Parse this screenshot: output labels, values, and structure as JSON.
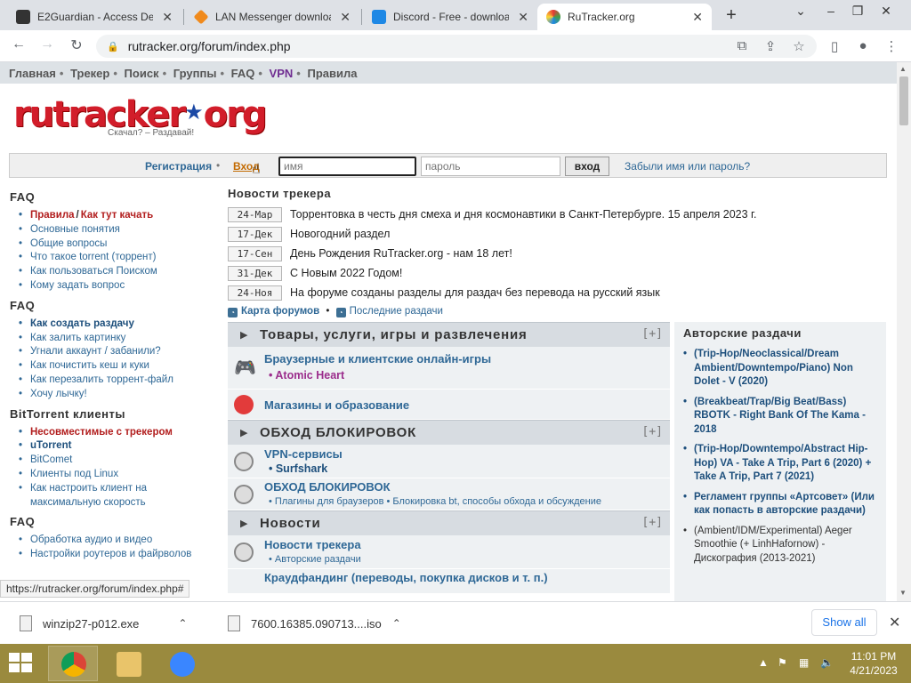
{
  "browser": {
    "tabs": [
      {
        "title": "E2Guardian - Access Den",
        "close": "✕"
      },
      {
        "title": "LAN Messenger downloa",
        "close": "✕"
      },
      {
        "title": "Discord - Free - downloa",
        "close": "✕"
      },
      {
        "title": "RuTracker.org",
        "close": "✕"
      }
    ],
    "url": "rutracker.org/forum/index.php",
    "status_link": "https://rutracker.org/forum/index.php#"
  },
  "topnav": {
    "items": [
      "Главная",
      "Трекер",
      "Поиск",
      "Группы",
      "FAQ",
      "VPN",
      "Правила"
    ]
  },
  "logo": {
    "text": "rutracker",
    "text2": "org",
    "slogan": "Скачал? – Раздавай!"
  },
  "login": {
    "register": "Регистрация",
    "login_link": "Вход",
    "user_placeholder": "имя",
    "pass_placeholder": "пароль",
    "button": "вход",
    "forgot": "Забыли имя или пароль?"
  },
  "sidebar": {
    "sections": [
      {
        "head": "FAQ",
        "items": [
          "Правила",
          "Как тут качать",
          "Основные понятия",
          "Общие вопросы",
          "Что такое torrent (торрент)",
          "Как пользоваться Поиском",
          "Кому задать вопрос"
        ]
      },
      {
        "head": "FAQ",
        "items": [
          "Как создать раздачу",
          "Как залить картинку",
          "Угнали аккаунт / забанили?",
          "Как почистить кеш и куки",
          "Как перезалить торрент-файл",
          "Хочу лычку!"
        ]
      },
      {
        "head": "BitTorrent клиенты",
        "items": [
          "Несовместимые с трекером",
          "uTorrent",
          "BitComet",
          "Клиенты под Linux",
          "Как настроить клиент на максимальную скорость"
        ]
      },
      {
        "head": "FAQ",
        "items": [
          "Обработка аудио и видео",
          "Настройки роутеров и файрволов"
        ]
      }
    ],
    "slash": "/"
  },
  "news": {
    "head": "Новости трекера",
    "rows": [
      {
        "date": "24-Мар",
        "text": "Торрентовка в честь дня смеха и дня космонавтики в Санкт-Петербурге. 15 апреля 2023 г."
      },
      {
        "date": "17-Дек",
        "text": "Новогодний раздел"
      },
      {
        "date": "17-Сен",
        "text": "День Рождения RuTracker.org - нам 18 лет!"
      },
      {
        "date": "31-Дек",
        "text": "С Новым 2022 Годом!"
      },
      {
        "date": "24-Ноя",
        "text": "На форуме созданы разделы для раздач без перевода на русский язык"
      }
    ],
    "map_link": "Карта форумов",
    "recent_link": "Последние раздачи",
    "dot": "•"
  },
  "forum": {
    "plus": "[+]",
    "cat1": "Товары, услуги, игры и развлечения",
    "games": "Браузерные и клиентские онлайн-игры",
    "games_sub": "• Atomic Heart",
    "shops": "Магазины и образование",
    "cat2": "ОБХОД БЛОКИРОВОК",
    "vpn": "VPN-сервисы",
    "vpn_sub": "• Surfshark",
    "bypass": "ОБХОД БЛОКИРОВОК",
    "bypass_sub": "• Плагины для браузеров • Блокировка bt, способы обхода и обсуждение",
    "cat3": "Новости",
    "tracker_news": "Новости трекера",
    "tracker_news_sub": "• Авторские раздачи",
    "crowd": "Краудфандинг (переводы, покупка дисков и т. п.)"
  },
  "authors": {
    "head": "Авторские раздачи",
    "items": [
      "(Trip-Hop/Neoclassical/Dream Ambient/Downtempo/Piano) Non Dolet - V (2020)",
      "(Breakbeat/Trap/Big Beat/Bass) RBOTK - Right Bank Of The Kama - 2018",
      "(Trip-Hop/Downtempo/Abstract Hip-Hop) VA - Take A Trip, Part 6 (2020) + Take A Trip, Part 7 (2021)",
      "Регламент группы «Артсовет» (Или как попасть в авторские раздачи)",
      "(Ambient/IDM/Experimental) Aeger Smoothie (+ LinhHafornow) - Дискография (2013-2021)"
    ]
  },
  "downloads": {
    "items": [
      "winzip27-p012.exe",
      "7600.16385.090713....iso"
    ],
    "show_all": "Show all"
  },
  "taskbar": {
    "time": "11:01 PM",
    "date": "4/21/2023"
  }
}
